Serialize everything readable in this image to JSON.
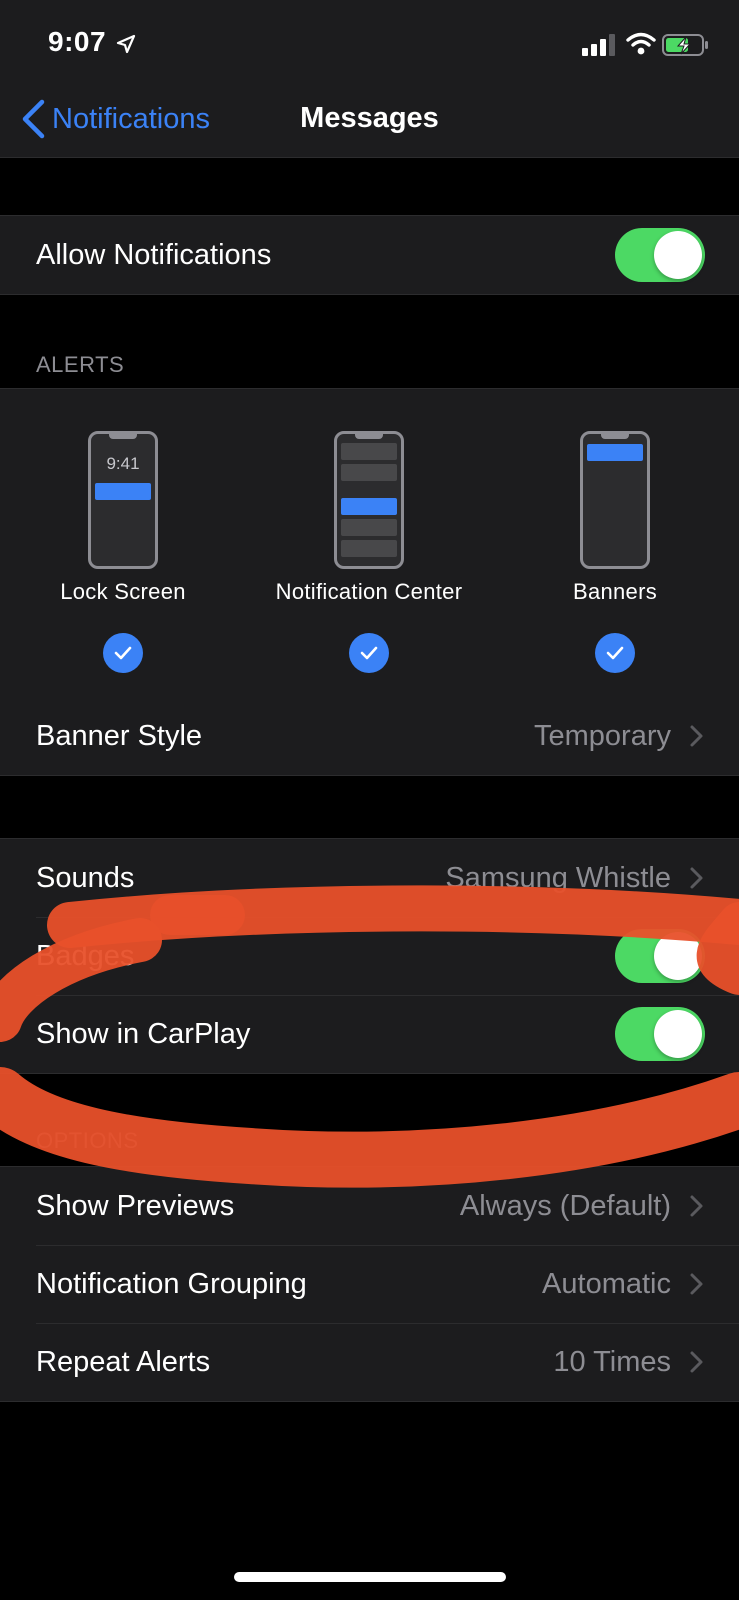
{
  "status_bar": {
    "time": "9:07"
  },
  "nav": {
    "back_label": "Notifications",
    "title": "Messages"
  },
  "allow_notifications": {
    "label": "Allow Notifications",
    "enabled": true
  },
  "alerts": {
    "header": "ALERTS",
    "options": [
      {
        "label": "Lock Screen",
        "checked": true,
        "preview_time": "9:41"
      },
      {
        "label": "Notification Center",
        "checked": true
      },
      {
        "label": "Banners",
        "checked": true
      }
    ],
    "banner_style": {
      "label": "Banner Style",
      "value": "Temporary"
    }
  },
  "sounds_group": {
    "sounds": {
      "label": "Sounds",
      "value": "Samsung Whistle"
    },
    "badges": {
      "label": "Badges",
      "enabled": true
    },
    "carplay": {
      "label": "Show in CarPlay",
      "enabled": true
    }
  },
  "options": {
    "header": "OPTIONS",
    "show_previews": {
      "label": "Show Previews",
      "value": "Always (Default)"
    },
    "grouping": {
      "label": "Notification Grouping",
      "value": "Automatic"
    },
    "repeat_alerts": {
      "label": "Repeat Alerts",
      "value": "10 Times"
    }
  },
  "colors": {
    "accent": "#3b82f6",
    "toggle_on": "#4cd964",
    "scribble": "#e8502a"
  }
}
